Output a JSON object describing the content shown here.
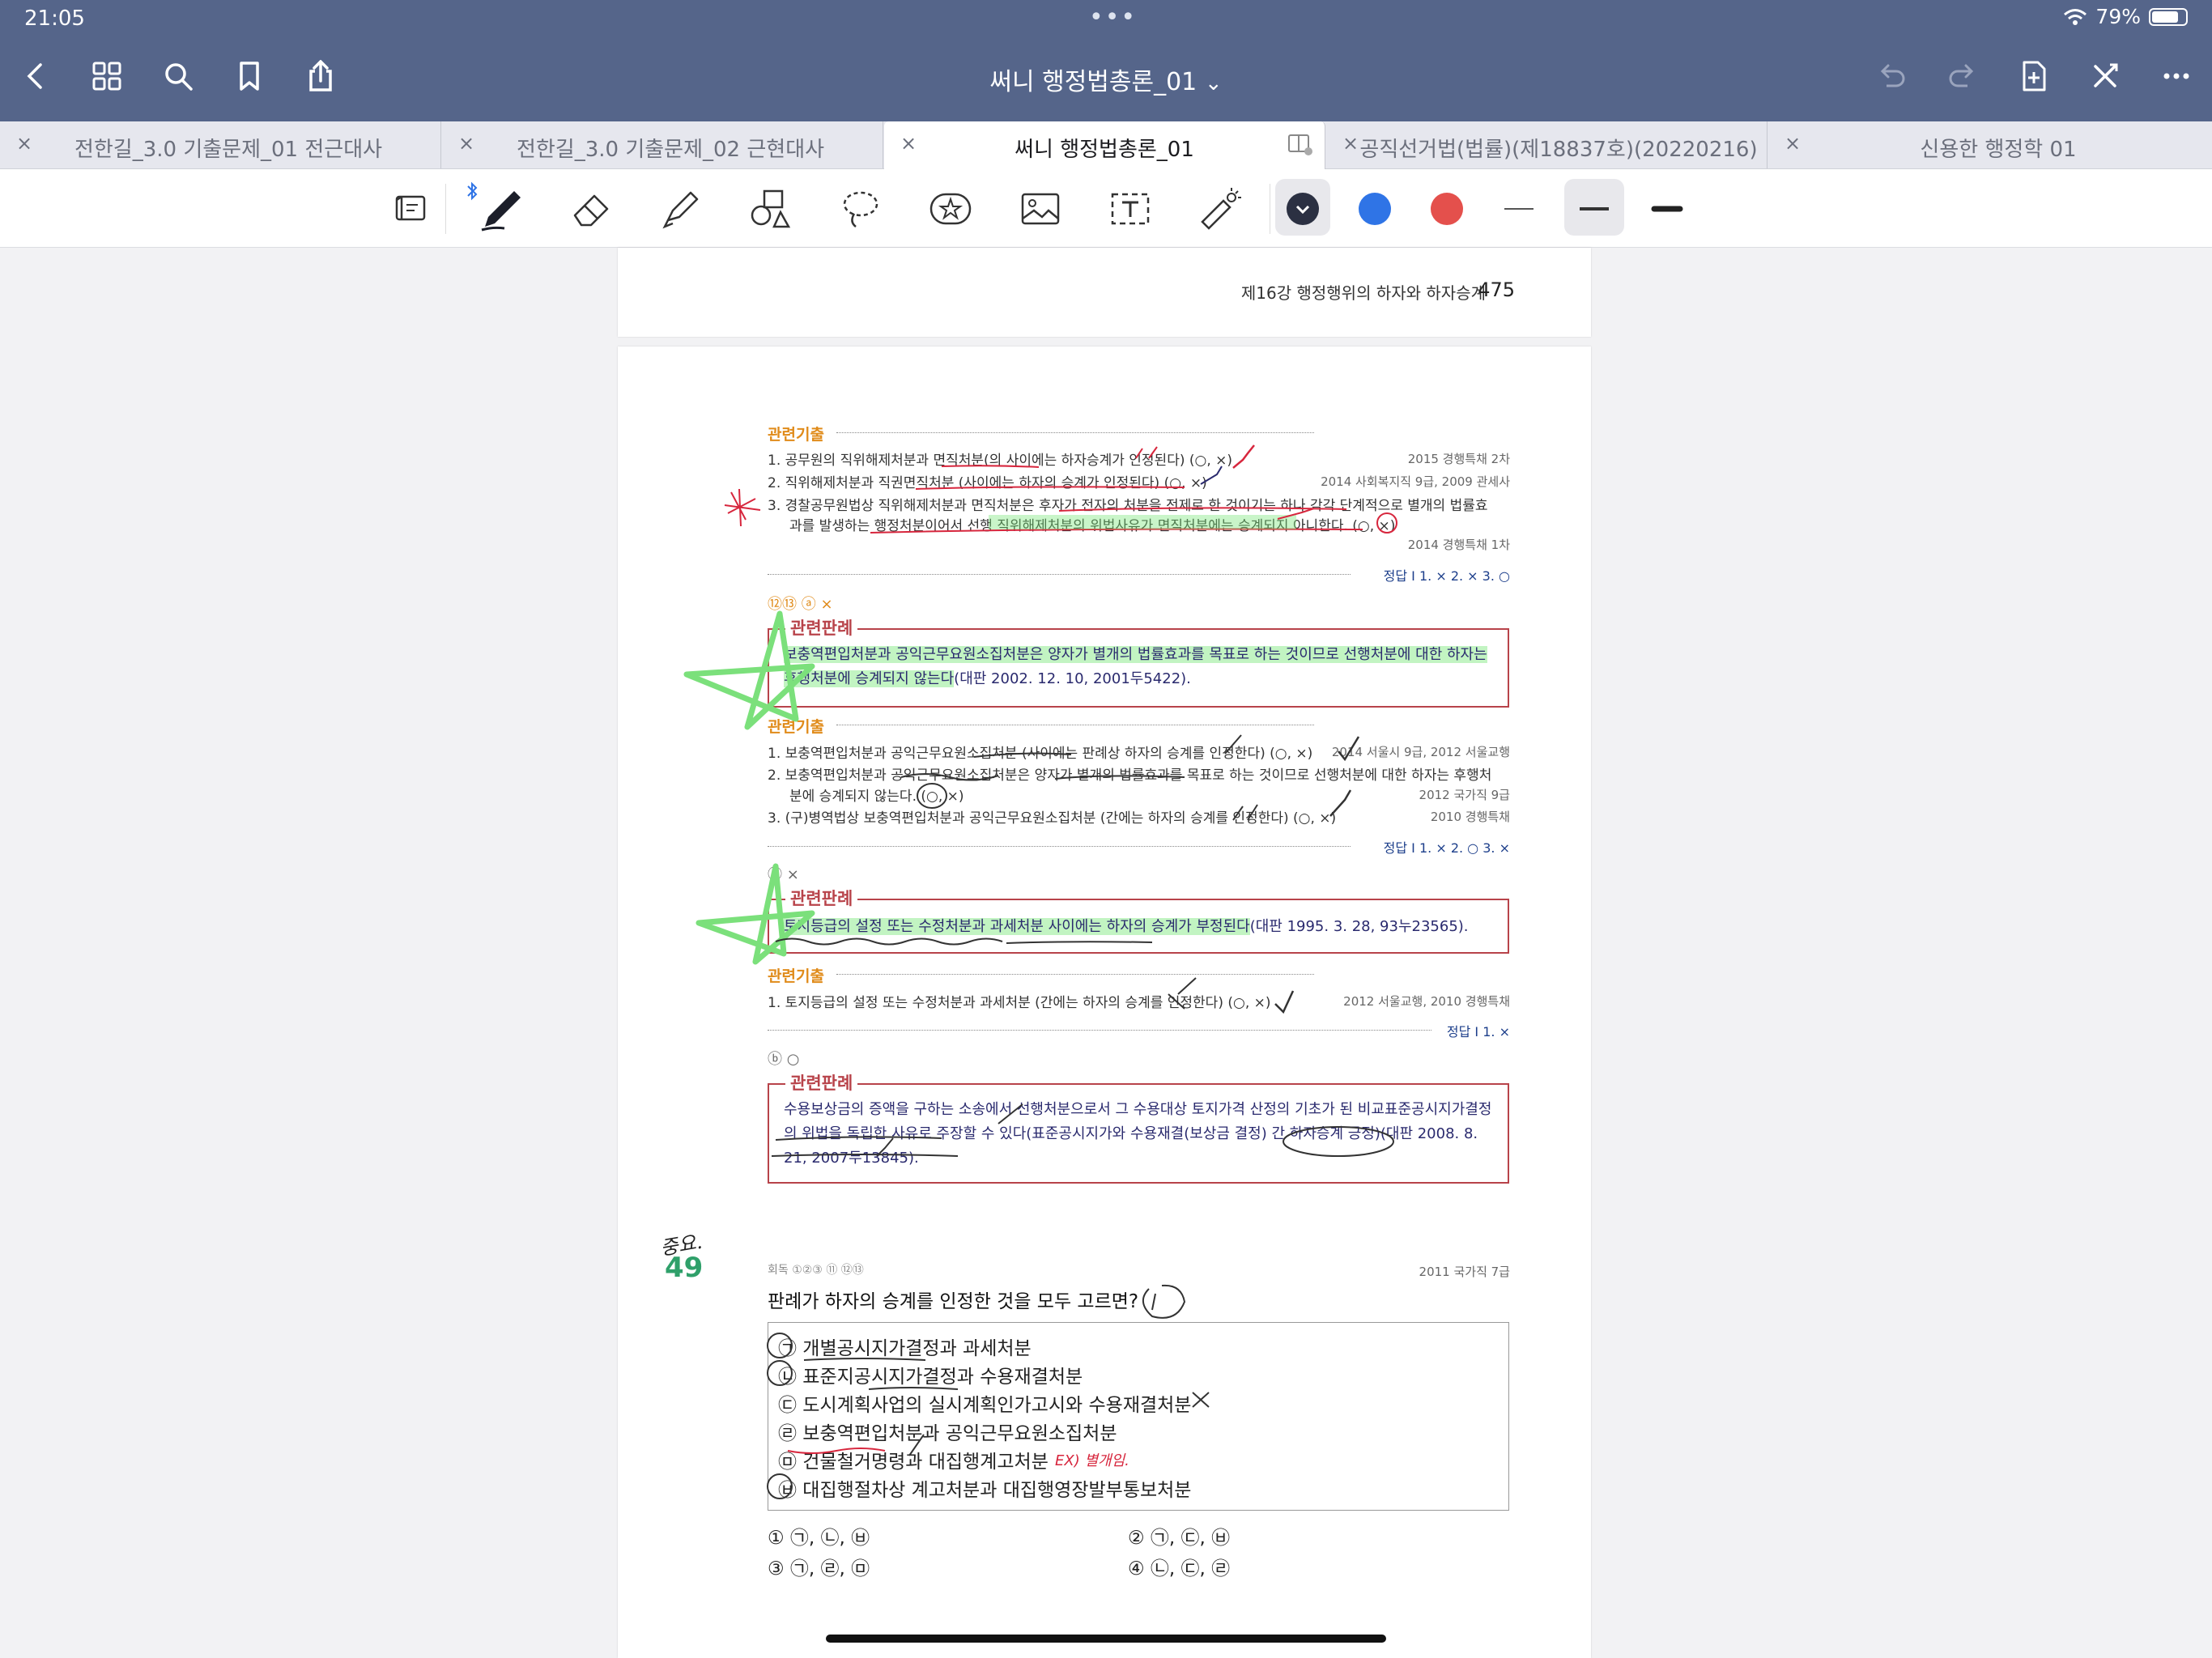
{
  "status": {
    "time": "21:05",
    "more_dots": "•••",
    "battery_pct": "79%",
    "battery_level": 0.79
  },
  "nav": {
    "doc_title": "써니 행정법총론_01",
    "title_chevron": "⌄"
  },
  "tabs": [
    {
      "label": "전한길_3.0 기출문제_01 전근대사",
      "close": "×"
    },
    {
      "label": "전한길_3.0 기출문제_02 근현대사",
      "close": "×"
    },
    {
      "label": "써니 행정법총론_01",
      "close": "×"
    },
    {
      "label": "공직선거법(법률)(제18837호)(20220216)",
      "close": "×"
    },
    {
      "label": "신용한 행정학 01",
      "close": "×"
    }
  ],
  "toolbar": {
    "tools": [
      "read-mode-icon",
      "pen-icon",
      "eraser-icon",
      "highlighter-icon",
      "shapes-icon",
      "lasso-icon",
      "sticker-icon",
      "image-icon",
      "text-box-icon",
      "laser-pointer-icon"
    ],
    "colors": [
      "#2b3042",
      "#2f74e6",
      "#e4504c"
    ],
    "bluetooth": "bluetooth-icon"
  },
  "page1": {
    "header_left": "제16강  행정행위의 하자와 하자승계",
    "page_number": "475"
  },
  "sec1": {
    "label": "관련기출",
    "items": [
      {
        "text": "1.  공무원의 직위해제처분과 면직처분(의 사이에는 하자승계가 인정된다) (○, ×)",
        "source": "2015 경행특채 2차"
      },
      {
        "text": "2.  직위해제처분과 직권면직처분 (사이에는 하자의 승계가 인정된다) (○, ×)",
        "source": "2014 사회복지직 9급, 2009 관세사"
      },
      {
        "text": "3.  경찰공무원법상 직위해제처분과 면직처분은 후자가 전자의 처분을 전제로 한 것이기는 하나 각각 단계적으로 별개의 법률효",
        "source": ""
      },
      {
        "text": "과를 발생하는 행정처분이어서 선행 직위해제처분의 위법사유가 면직처분에는 승계되지 아니한다. (○, ×)",
        "source": "2014 경행특채 1차"
      }
    ],
    "answer": "정답 I  1. ×  2. ×  3. ○"
  },
  "box1": {
    "marks": "⑫⑬ ⓐ ×",
    "title": "관련판례",
    "text_hl": "보충역편입처분과 공익근무요원소집처분은 양자가 별개의 법률효과를 목표로 하는 것이므로 선행처분에 대한 하자는 후행처분에 승계되지 않는다",
    "text_tail": "(대판 2002. 12. 10, 2001두5422)."
  },
  "sec2": {
    "label": "관련기출",
    "items": [
      {
        "text": "1.  보충역편입처분과 공익근무요원소집처분 (사이에는 판례상 하자의 승계를 인정한다) (○, ×)",
        "source": "2014 서울시 9급, 2012 서울교행"
      },
      {
        "text": "2.  보충역편입처분과 공익근무요원소집처분은 양자가 별개의 법률효과를 목표로 하는 것이므로 선행처분에 대한 하자는 후행처",
        "source": ""
      },
      {
        "text": "분에 승계되지 않는다. (○, ×)",
        "source": "2012 국가직 9급"
      },
      {
        "text": "3.  (구)병역법상 보충역편입처분과 공익근무요원소집처분 (간에는 하자의 승계를 인정한다) (○, ×)",
        "source": "2010 경행특채"
      }
    ],
    "answer": "정답 I  1. ×  2. ○  3. ×"
  },
  "box2": {
    "marks": "ⓐ ×",
    "title": "관련판례",
    "text_hl": "토지등급의 설정 또는 수정처분과 과세처분 사이에는 하자의 승계가 부정된다",
    "text_tail": "(대판 1995. 3. 28, 93누23565)."
  },
  "sec3": {
    "label": "관련기출",
    "items": [
      {
        "text": "1.  토지등급의 설정 또는 수정처분과 과세처분 (간에는 하자의 승계를 인정한다) (○, ×)",
        "source": "2012 서울교행, 2010 경행특채"
      }
    ],
    "answer": "정답 I  1. ×"
  },
  "box3": {
    "marks": "ⓑ ○",
    "title": "관련판례",
    "text": "수용보상금의 증액을 구하는 소송에서 선행처분으로서 그 수용대상 토지가격 산정의 기초가 된 비교표준공시지가결정의 위법을 독립한 사유로 주장할 수 있다(표준공시지가와 수용재결(보상금 결정) 간 하자승계 긍정)(대판 2008. 8. 21, 2007두13845)."
  },
  "q49": {
    "number": "49",
    "meta": "회독 ①②③  ⑪ ⑫⑬",
    "year": "2011 국가직 7급",
    "question": "판례가 하자의 승계를 인정한 것을 모두 고르면?",
    "options": [
      "㉠ 개별공시지가결정과 과세처분",
      "㉡ 표준지공시지가결정과 수용재결처분",
      "㉢ 도시계획사업의 실시계획인가고시와 수용재결처분",
      "㉣ 보충역편입처분과 공익근무요원소집처분",
      "㉤ 건물철거명령과 대집행계고처분",
      "㉥ 대집행절차상 계고처분과 대집행영장발부통보처분"
    ],
    "answers": [
      "① ㉠, ㉡, ㉥",
      "② ㉠, ㉢, ㉥",
      "③ ㉠, ㉣, ㉤",
      "④ ㉡, ㉢, ㉣"
    ]
  },
  "handwriting": {
    "margin_note": "중요.",
    "ex_note": "EX) 별개임."
  }
}
